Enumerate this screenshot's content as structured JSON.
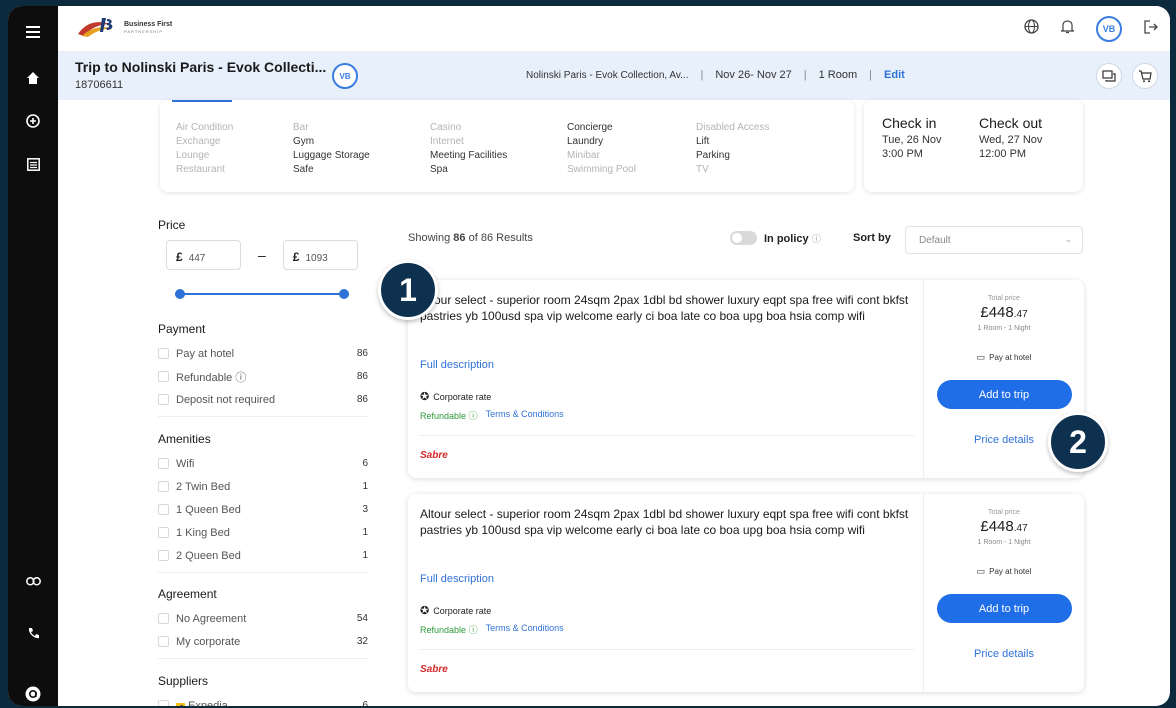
{
  "brand": {
    "logo_line1": "Business First",
    "logo_line2": "PARTNERSHIP"
  },
  "user": {
    "initials": "VB"
  },
  "trip": {
    "title": "Trip to Nolinski Paris - Evok Collecti...",
    "id": "18706611",
    "hotel": "Nolinski Paris - Evok Collection, Av...",
    "dates": "Nov 26- Nov 27",
    "rooms": "1 Room",
    "edit_label": "Edit"
  },
  "amenities": [
    {
      "label": "Air Condition",
      "on": false
    },
    {
      "label": "Bar",
      "on": false
    },
    {
      "label": "Casino",
      "on": false
    },
    {
      "label": "Concierge",
      "on": true
    },
    {
      "label": "Disabled Access",
      "on": false
    },
    {
      "label": "Exchange",
      "on": false
    },
    {
      "label": "Gym",
      "on": true
    },
    {
      "label": "Internet",
      "on": false
    },
    {
      "label": "Laundry",
      "on": true
    },
    {
      "label": "Lift",
      "on": true
    },
    {
      "label": "Lounge",
      "on": false
    },
    {
      "label": "Luggage Storage",
      "on": true
    },
    {
      "label": "Meeting Facilities",
      "on": true
    },
    {
      "label": "Minibar",
      "on": false
    },
    {
      "label": "Parking",
      "on": true
    },
    {
      "label": "Restaurant",
      "on": false
    },
    {
      "label": "Safe",
      "on": true
    },
    {
      "label": "Spa",
      "on": true
    },
    {
      "label": "Swimming Pool",
      "on": false
    },
    {
      "label": "TV",
      "on": false
    }
  ],
  "stay": {
    "checkin_label": "Check in",
    "checkin_date": "Tue, 26 Nov",
    "checkin_time": "3:00 PM",
    "checkout_label": "Check out",
    "checkout_date": "Wed, 27 Nov",
    "checkout_time": "12:00 PM"
  },
  "filters": {
    "price_label": "Price",
    "currency": "£",
    "min": "447",
    "max": "1093",
    "range_fraction": [
      0.0,
      1.0
    ],
    "payment": {
      "title": "Payment",
      "items": [
        {
          "label": "Pay at hotel",
          "count": "86"
        },
        {
          "label": "Refundable ⓘ",
          "count": "86"
        },
        {
          "label": "Deposit not required",
          "count": "86"
        }
      ]
    },
    "amenities": {
      "title": "Amenities",
      "items": [
        {
          "label": "Wifi",
          "count": "6"
        },
        {
          "label": "2 Twin Bed",
          "count": "1"
        },
        {
          "label": "1 Queen Bed",
          "count": "3"
        },
        {
          "label": "1 King Bed",
          "count": "1"
        },
        {
          "label": "2 Queen Bed",
          "count": "1"
        }
      ]
    },
    "agreement": {
      "title": "Agreement",
      "items": [
        {
          "label": "No Agreement",
          "count": "54"
        },
        {
          "label": "My corporate",
          "count": "32"
        }
      ]
    },
    "suppliers": {
      "title": "Suppliers",
      "items": [
        {
          "label": "Expedia",
          "count": "6"
        }
      ]
    }
  },
  "results": {
    "showing_prefix": "Showing",
    "shown": "86",
    "of_word": "of",
    "total": "86",
    "results_word": "Results",
    "in_policy": "In policy",
    "sort_label": "Sort by",
    "sort_value": "Default"
  },
  "cards": [
    {
      "title": "Altour select - superior room 24sqm 2pax 1dbl bd shower luxury eqpt spa free wifi cont bkfst pastries yb 100usd spa vip welcome early ci boa late co boa upg boa hsia comp wifi",
      "full_desc": "Full description",
      "corporate": "Corporate rate",
      "refundable": "Refundable",
      "terms": "Terms & Conditions",
      "supplier": "Sabre",
      "total_label": "Total price",
      "price_main": "£448",
      "price_cents": ".47",
      "rooms_nights": "1 Room - 1 Night",
      "payment": "Pay at hotel",
      "add_label": "Add to trip",
      "details_label": "Price details"
    },
    {
      "title": "Altour select - superior room 24sqm 2pax 1dbl bd shower luxury eqpt spa free wifi cont bkfst pastries yb 100usd spa vip welcome early ci boa late co boa upg boa hsia comp wifi",
      "full_desc": "Full description",
      "corporate": "Corporate rate",
      "refundable": "Refundable",
      "terms": "Terms & Conditions",
      "supplier": "Sabre",
      "total_label": "Total price",
      "price_main": "£448",
      "price_cents": ".47",
      "rooms_nights": "1 Room - 1 Night",
      "payment": "Pay at hotel",
      "add_label": "Add to trip",
      "details_label": "Price details"
    }
  ],
  "callouts": [
    "1",
    "2"
  ],
  "colors": {
    "accent": "#1f6ee8",
    "sidebar": "#0d0d0d",
    "tripbar": "#e7f0fb",
    "callout": "#0e3150",
    "supplier": "#d42a2a"
  }
}
